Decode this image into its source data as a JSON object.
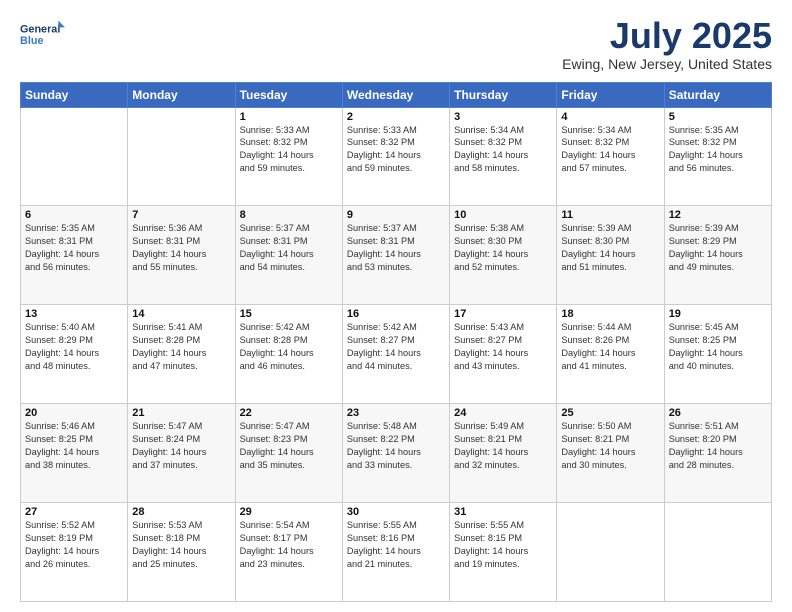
{
  "logo": {
    "line1": "General",
    "line2": "Blue"
  },
  "title": "July 2025",
  "subtitle": "Ewing, New Jersey, United States",
  "days_header": [
    "Sunday",
    "Monday",
    "Tuesday",
    "Wednesday",
    "Thursday",
    "Friday",
    "Saturday"
  ],
  "weeks": [
    [
      {
        "day": "",
        "info": ""
      },
      {
        "day": "",
        "info": ""
      },
      {
        "day": "1",
        "info": "Sunrise: 5:33 AM\nSunset: 8:32 PM\nDaylight: 14 hours\nand 59 minutes."
      },
      {
        "day": "2",
        "info": "Sunrise: 5:33 AM\nSunset: 8:32 PM\nDaylight: 14 hours\nand 59 minutes."
      },
      {
        "day": "3",
        "info": "Sunrise: 5:34 AM\nSunset: 8:32 PM\nDaylight: 14 hours\nand 58 minutes."
      },
      {
        "day": "4",
        "info": "Sunrise: 5:34 AM\nSunset: 8:32 PM\nDaylight: 14 hours\nand 57 minutes."
      },
      {
        "day": "5",
        "info": "Sunrise: 5:35 AM\nSunset: 8:32 PM\nDaylight: 14 hours\nand 56 minutes."
      }
    ],
    [
      {
        "day": "6",
        "info": "Sunrise: 5:35 AM\nSunset: 8:31 PM\nDaylight: 14 hours\nand 56 minutes."
      },
      {
        "day": "7",
        "info": "Sunrise: 5:36 AM\nSunset: 8:31 PM\nDaylight: 14 hours\nand 55 minutes."
      },
      {
        "day": "8",
        "info": "Sunrise: 5:37 AM\nSunset: 8:31 PM\nDaylight: 14 hours\nand 54 minutes."
      },
      {
        "day": "9",
        "info": "Sunrise: 5:37 AM\nSunset: 8:31 PM\nDaylight: 14 hours\nand 53 minutes."
      },
      {
        "day": "10",
        "info": "Sunrise: 5:38 AM\nSunset: 8:30 PM\nDaylight: 14 hours\nand 52 minutes."
      },
      {
        "day": "11",
        "info": "Sunrise: 5:39 AM\nSunset: 8:30 PM\nDaylight: 14 hours\nand 51 minutes."
      },
      {
        "day": "12",
        "info": "Sunrise: 5:39 AM\nSunset: 8:29 PM\nDaylight: 14 hours\nand 49 minutes."
      }
    ],
    [
      {
        "day": "13",
        "info": "Sunrise: 5:40 AM\nSunset: 8:29 PM\nDaylight: 14 hours\nand 48 minutes."
      },
      {
        "day": "14",
        "info": "Sunrise: 5:41 AM\nSunset: 8:28 PM\nDaylight: 14 hours\nand 47 minutes."
      },
      {
        "day": "15",
        "info": "Sunrise: 5:42 AM\nSunset: 8:28 PM\nDaylight: 14 hours\nand 46 minutes."
      },
      {
        "day": "16",
        "info": "Sunrise: 5:42 AM\nSunset: 8:27 PM\nDaylight: 14 hours\nand 44 minutes."
      },
      {
        "day": "17",
        "info": "Sunrise: 5:43 AM\nSunset: 8:27 PM\nDaylight: 14 hours\nand 43 minutes."
      },
      {
        "day": "18",
        "info": "Sunrise: 5:44 AM\nSunset: 8:26 PM\nDaylight: 14 hours\nand 41 minutes."
      },
      {
        "day": "19",
        "info": "Sunrise: 5:45 AM\nSunset: 8:25 PM\nDaylight: 14 hours\nand 40 minutes."
      }
    ],
    [
      {
        "day": "20",
        "info": "Sunrise: 5:46 AM\nSunset: 8:25 PM\nDaylight: 14 hours\nand 38 minutes."
      },
      {
        "day": "21",
        "info": "Sunrise: 5:47 AM\nSunset: 8:24 PM\nDaylight: 14 hours\nand 37 minutes."
      },
      {
        "day": "22",
        "info": "Sunrise: 5:47 AM\nSunset: 8:23 PM\nDaylight: 14 hours\nand 35 minutes."
      },
      {
        "day": "23",
        "info": "Sunrise: 5:48 AM\nSunset: 8:22 PM\nDaylight: 14 hours\nand 33 minutes."
      },
      {
        "day": "24",
        "info": "Sunrise: 5:49 AM\nSunset: 8:21 PM\nDaylight: 14 hours\nand 32 minutes."
      },
      {
        "day": "25",
        "info": "Sunrise: 5:50 AM\nSunset: 8:21 PM\nDaylight: 14 hours\nand 30 minutes."
      },
      {
        "day": "26",
        "info": "Sunrise: 5:51 AM\nSunset: 8:20 PM\nDaylight: 14 hours\nand 28 minutes."
      }
    ],
    [
      {
        "day": "27",
        "info": "Sunrise: 5:52 AM\nSunset: 8:19 PM\nDaylight: 14 hours\nand 26 minutes."
      },
      {
        "day": "28",
        "info": "Sunrise: 5:53 AM\nSunset: 8:18 PM\nDaylight: 14 hours\nand 25 minutes."
      },
      {
        "day": "29",
        "info": "Sunrise: 5:54 AM\nSunset: 8:17 PM\nDaylight: 14 hours\nand 23 minutes."
      },
      {
        "day": "30",
        "info": "Sunrise: 5:55 AM\nSunset: 8:16 PM\nDaylight: 14 hours\nand 21 minutes."
      },
      {
        "day": "31",
        "info": "Sunrise: 5:55 AM\nSunset: 8:15 PM\nDaylight: 14 hours\nand 19 minutes."
      },
      {
        "day": "",
        "info": ""
      },
      {
        "day": "",
        "info": ""
      }
    ]
  ]
}
